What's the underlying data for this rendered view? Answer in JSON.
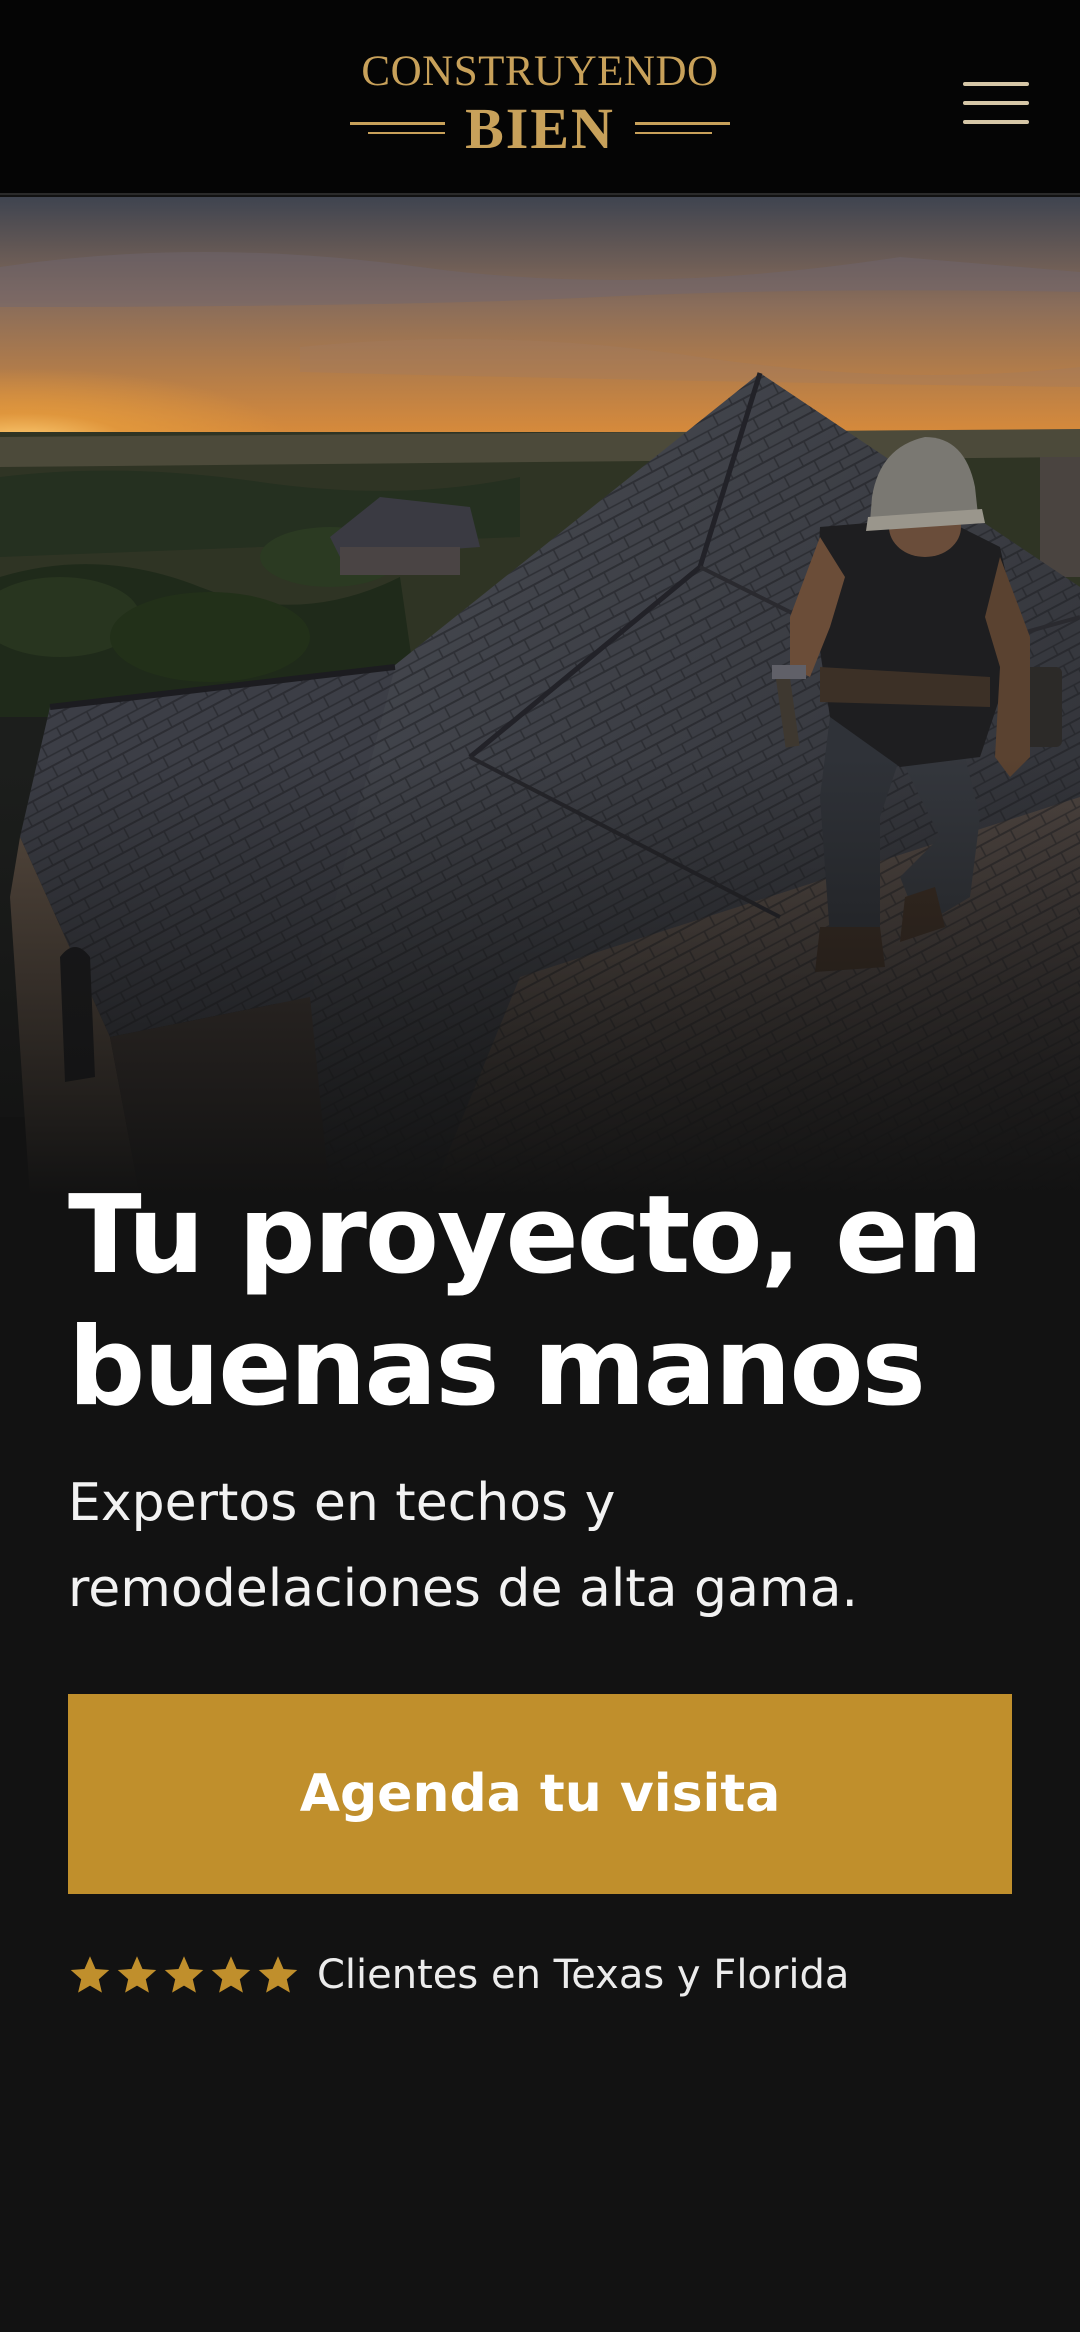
{
  "header": {
    "logo_line1": "CONSTRUYENDO",
    "logo_line2": "BIEN",
    "menu_icon": "hamburger-menu-icon"
  },
  "hero": {
    "image_description_icon": "roofer-photo"
  },
  "content": {
    "headline_line1": "Tu proyecto, en",
    "headline_line2": "buenas manos",
    "subhead_line1": "Expertos en techos y",
    "subhead_line2": "remodelaciones de alta gama.",
    "cta_label": "Agenda tu visita",
    "rating_stars": 5,
    "rating_text": "Clientes en Texas y Florida"
  },
  "colors": {
    "accent": "#c08f2c",
    "logo_gold": "#c8a15a",
    "background": "#121212",
    "header_bg": "#050505"
  }
}
